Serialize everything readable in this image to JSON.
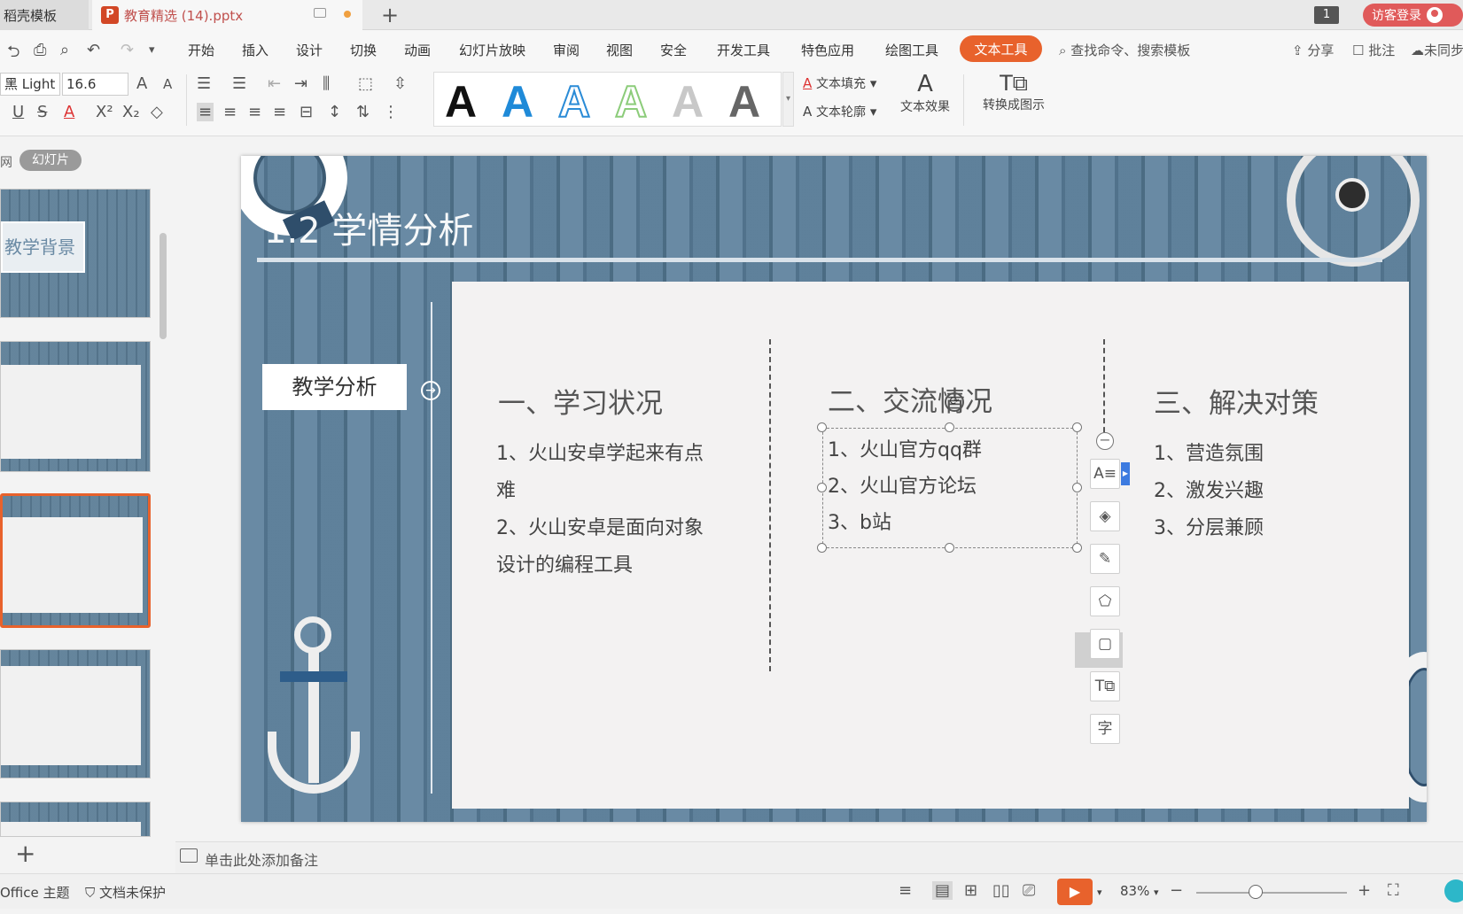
{
  "tabs": {
    "template_tab": "稻壳模板",
    "doc_tab": "教育精选 (14).pptx",
    "ppt_icon": "P",
    "new_tab": "+",
    "window_count": "1",
    "guest_login": "访客登录"
  },
  "menu": {
    "items": [
      "开始",
      "插入",
      "设计",
      "切换",
      "动画",
      "幻灯片放映",
      "审阅",
      "视图",
      "安全",
      "开发工具",
      "特色应用",
      "绘图工具"
    ],
    "active": "文本工具",
    "search": "查找命令、搜索模板",
    "share": "分享",
    "comment": "批注",
    "sync": "未同步"
  },
  "ribbon": {
    "font_name": "黑 Light",
    "font_size": "16.6",
    "style_letter": "A",
    "text_fill": "文本填充",
    "text_outline": "文本轮廓",
    "text_effect": "文本效果",
    "convert_to_diagram": "转换成图示"
  },
  "left_panel": {
    "tab_outline": "网",
    "tab_slides": "幻灯片",
    "thumb1_title": "教学背景",
    "add_slide": "+"
  },
  "slide": {
    "title": "1.2 学情分析",
    "side_box": "教学分析",
    "columns": [
      {
        "head": "一、学习状况",
        "items": [
          "1、火山安卓学起来有点",
          "难",
          "2、火山安卓是面向对象",
          "设计的编程工具"
        ]
      },
      {
        "head": "二、交流情况",
        "items": [
          "1、火山官方qq群",
          "2、火山官方论坛",
          "3、b站"
        ]
      },
      {
        "head": "三、解决对策",
        "items": [
          "1、营造氛围",
          "2、激发兴趣",
          "3、分层兼顾"
        ]
      }
    ]
  },
  "notes": {
    "placeholder": "单击此处添加备注"
  },
  "status": {
    "theme": "Office 主题",
    "protection": "文档未保护",
    "zoom": "83%"
  },
  "colors": {
    "accent": "#e8622c",
    "guest": "#e05a5a",
    "slide_bg": "#5d7f99"
  }
}
